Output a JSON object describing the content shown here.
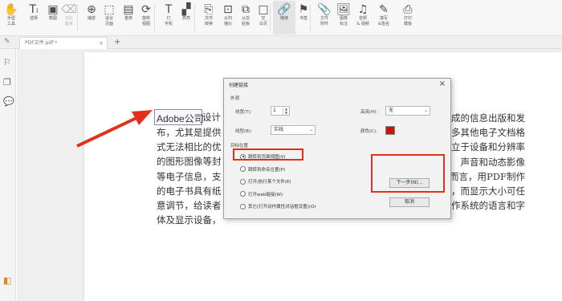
{
  "toolbar": {
    "buttons": [
      {
        "icon": "hand-icon",
        "glyph": "✋",
        "label": "手型\n工具"
      },
      {
        "icon": "select-text-icon",
        "glyph": "Tᵢ",
        "label": "选择"
      },
      {
        "icon": "screenshot-icon",
        "glyph": "▣",
        "label": "截图"
      },
      {
        "icon": "clear-icon",
        "glyph": "⌫",
        "label": "对比\n版本"
      },
      {
        "icon": "zoom-icon",
        "glyph": "⊕",
        "label": "缩放"
      },
      {
        "icon": "fit-page-icon",
        "glyph": "⬚",
        "label": "适合\n页面"
      },
      {
        "icon": "reflow-icon",
        "glyph": "▤",
        "label": "重排"
      },
      {
        "icon": "rotate-icon",
        "glyph": "⟳",
        "label": "旋转\n视图"
      },
      {
        "icon": "typewriter-icon",
        "glyph": "T",
        "label": "打\n字机"
      },
      {
        "icon": "highlight-icon",
        "glyph": "▞",
        "label": "高亮"
      },
      {
        "icon": "file-convert-icon",
        "glyph": "⎘",
        "label": "文件\n转换"
      },
      {
        "icon": "from-scan-icon",
        "glyph": "⊡",
        "label": "从扫\n描仪"
      },
      {
        "icon": "from-clipboard-icon",
        "glyph": "⧉",
        "label": "从剪\n贴板"
      },
      {
        "icon": "blank-page-icon",
        "glyph": "□",
        "label": "空\n白页"
      },
      {
        "icon": "link-icon",
        "glyph": "🔗",
        "label": "链接"
      },
      {
        "icon": "bookmark-icon",
        "glyph": "⚑",
        "label": "书签"
      },
      {
        "icon": "file-attachment-icon",
        "glyph": "📎",
        "label": "文件\n附件"
      },
      {
        "icon": "image-annotation-icon",
        "glyph": "🖼",
        "label": "图像\n标注"
      },
      {
        "icon": "audio-video-icon",
        "glyph": "♫",
        "label": "音频\n& 视频"
      },
      {
        "icon": "fill-sign-icon",
        "glyph": "✎",
        "label": "填写\n&签名"
      },
      {
        "icon": "print-icon",
        "glyph": "⎙",
        "label": "打印\n模板"
      }
    ]
  },
  "tabs": {
    "doc_tab": "PDF文件.pdf *",
    "close_glyph": "×",
    "new_tab_glyph": "+"
  },
  "document": {
    "highlighted_text": "Adobe公司",
    "lines_left": [
      "布，尤其是提供",
      "式无法相比的优",
      "的图形图像等封",
      "等电子信息，支",
      "的电子书具有纸",
      "意调节，给读者",
      "体及显示设备，"
    ],
    "first_line_left": "设计",
    "lines_right": [
      "成的信息出版和发",
      "多其他电子文档格",
      "立于设备和分辨率",
      "声音和动态影像",
      "者而言，用PDF制作",
      "，而显示大小可任",
      "作系统的语言和字"
    ]
  },
  "dialog": {
    "title": "创建链接",
    "close_glyph": "×",
    "appearance_section": "外观",
    "line_width_label": "线宽(T):",
    "line_width_value": "1",
    "highlight_label": "高亮(H):",
    "highlight_value": "无",
    "line_style_label": "线型(B):",
    "line_style_value": "实线",
    "color_label": "颜色(C):",
    "color_hex": "#d01010",
    "target_section": "目标位置",
    "options": [
      {
        "label": "跳转到页面视图(V)",
        "selected": true
      },
      {
        "label": "跳转到命名位置(P)",
        "selected": false
      },
      {
        "label": "打开/执行某个文件(E)",
        "selected": false
      },
      {
        "label": "打开web链接(W)",
        "selected": false
      },
      {
        "label": "其它(打开动作属性对话框设置)(O)",
        "selected": false
      }
    ],
    "next_button": "下一步(N)...",
    "cancel_button": "取消"
  },
  "annotation_color": "#e2301c"
}
